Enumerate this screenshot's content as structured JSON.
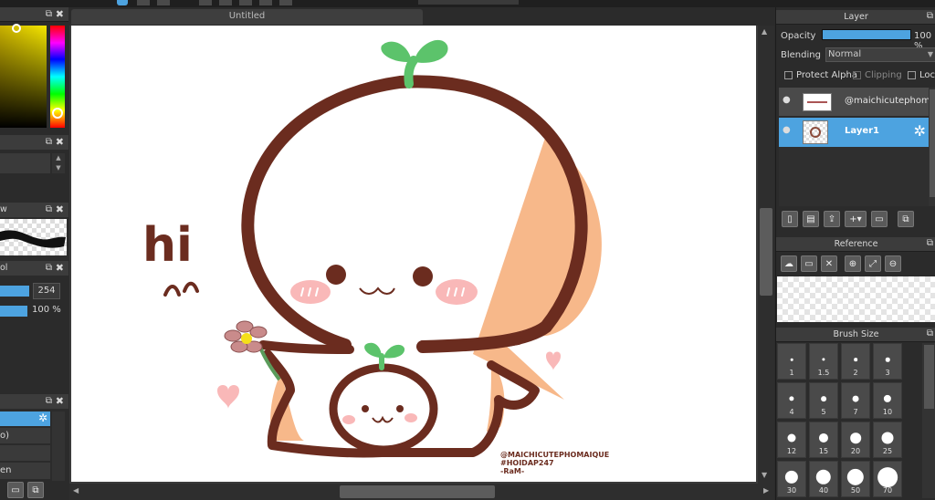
{
  "canvas": {
    "title": "Untitled"
  },
  "left_panels": {
    "brush_label_fragment": "w",
    "tool_label_fragment": "ol",
    "size_value": "254",
    "opacity_value": "100 %",
    "layer_rows": [
      "o)",
      "en"
    ]
  },
  "layer_panel": {
    "title": "Layer",
    "opacity_label": "Opacity",
    "opacity_value": "100 %",
    "opacity_fraction": 1.0,
    "blending_label": "Blending",
    "blending_value": "Normal",
    "protect_alpha": "Protect Alpha",
    "clipping": "Clipping",
    "lock": "Lock",
    "layers": [
      {
        "name": "@maichicutephom",
        "selected": false
      },
      {
        "name": "Layer1",
        "selected": true
      }
    ]
  },
  "reference_panel": {
    "title": "Reference"
  },
  "brush_size_panel": {
    "title": "Brush Size",
    "sizes": [
      "1",
      "1.5",
      "2",
      "3",
      "4",
      "5",
      "7",
      "10",
      "12",
      "15",
      "20",
      "25",
      "30",
      "40",
      "50",
      "70"
    ]
  },
  "artwork": {
    "greeting": "hi",
    "credit_lines": [
      "@MAICHICUTEPHOMAIQUE",
      "#HOIDAP247",
      "-RaM-"
    ]
  },
  "colors": {
    "accent": "#4da3e0",
    "outline": "#6b2c1f",
    "sprout": "#5cc36b",
    "shade": "#f7b88a",
    "blush": "#f9b8b8"
  }
}
